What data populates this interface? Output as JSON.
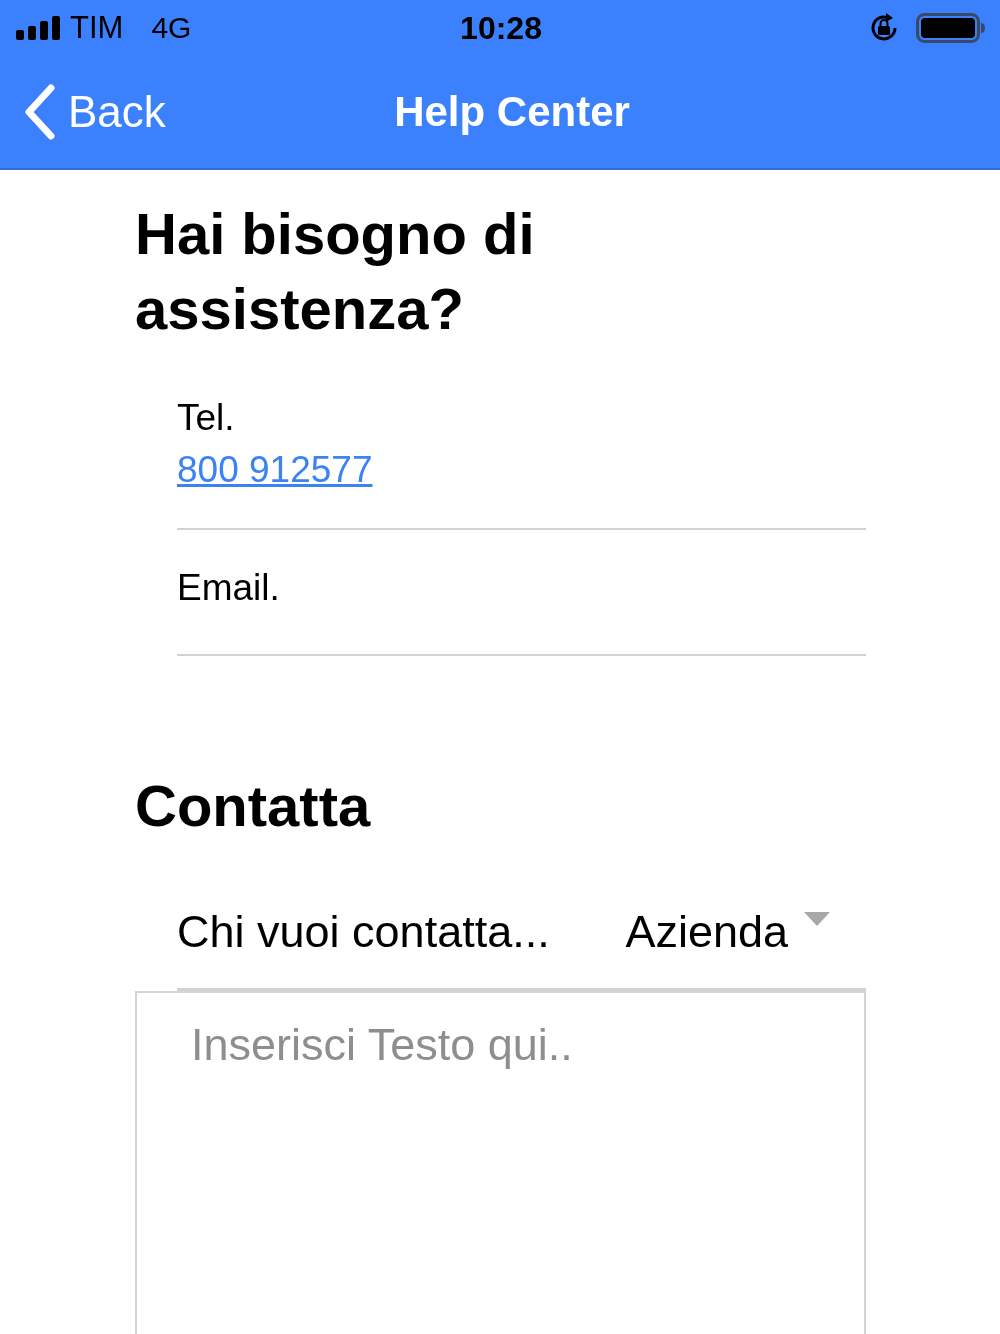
{
  "status_bar": {
    "carrier": "TIM",
    "network": "4G",
    "time": "10:28"
  },
  "nav_bar": {
    "back": "Back",
    "title": "Help Center"
  },
  "heading": "Hai bisogno di assistenza?",
  "contacts": [
    {
      "label": "Tel.",
      "value": "800 912577"
    },
    {
      "label": "Email."
    }
  ],
  "contact_form": {
    "heading": "Contatta",
    "picker": {
      "label": "Chi vuoi contatta...",
      "value": "Azienda"
    },
    "message": {
      "placeholder": "Inserisci Testo qui.."
    }
  }
}
